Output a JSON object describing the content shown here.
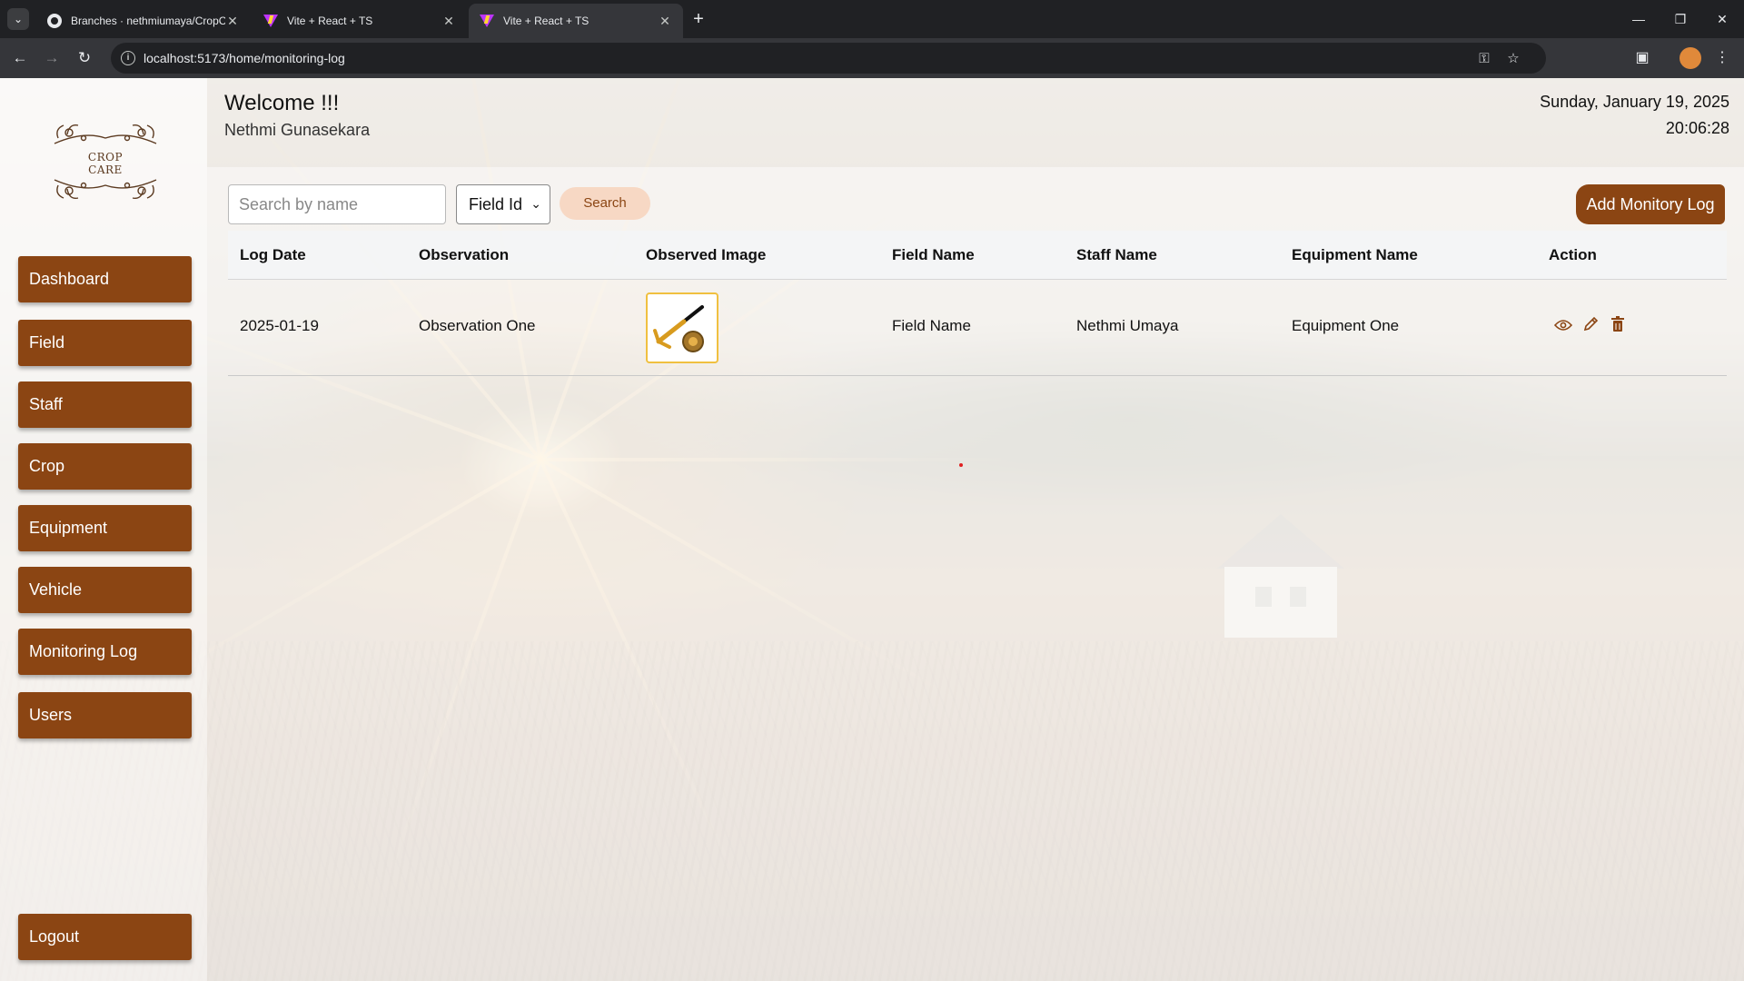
{
  "browser": {
    "tabs": [
      {
        "title": "Branches · nethmiumaya/CropC",
        "icon": "github-icon",
        "active": false
      },
      {
        "title": "Vite + React + TS",
        "icon": "vite-icon",
        "active": false
      },
      {
        "title": "Vite + React + TS",
        "icon": "vite-icon",
        "active": true
      }
    ],
    "url": "localhost:5173/home/monitoring-log"
  },
  "app": {
    "logo": {
      "line1": "CROP",
      "line2": "CARE"
    },
    "nav": [
      "Dashboard",
      "Field",
      "Staff",
      "Crop",
      "Equipment",
      "Vehicle",
      "Monitoring Log",
      "Users"
    ],
    "logout": "Logout",
    "header": {
      "welcome": "Welcome !!!",
      "user": "Nethmi Gunasekara",
      "date": "Sunday, January 19, 2025",
      "time": "20:06:28"
    },
    "toolbar": {
      "search_placeholder": "Search by name",
      "filter_value": "Field Id",
      "search_label": "Search",
      "add_label": "Add Monitory Log"
    },
    "table": {
      "columns": [
        "Log Date",
        "Observation",
        "Observed Image",
        "Field Name",
        "Staff Name",
        "Equipment Name",
        "Action"
      ],
      "rows": [
        {
          "date": "2025-01-19",
          "observation": "Observation One",
          "image": "observed-image",
          "field": "Field Name",
          "staff": "Nethmi Umaya",
          "equipment": "Equipment One"
        }
      ]
    }
  },
  "colors": {
    "accent": "#8b4513",
    "search_button_bg": "#f7d8c4"
  }
}
